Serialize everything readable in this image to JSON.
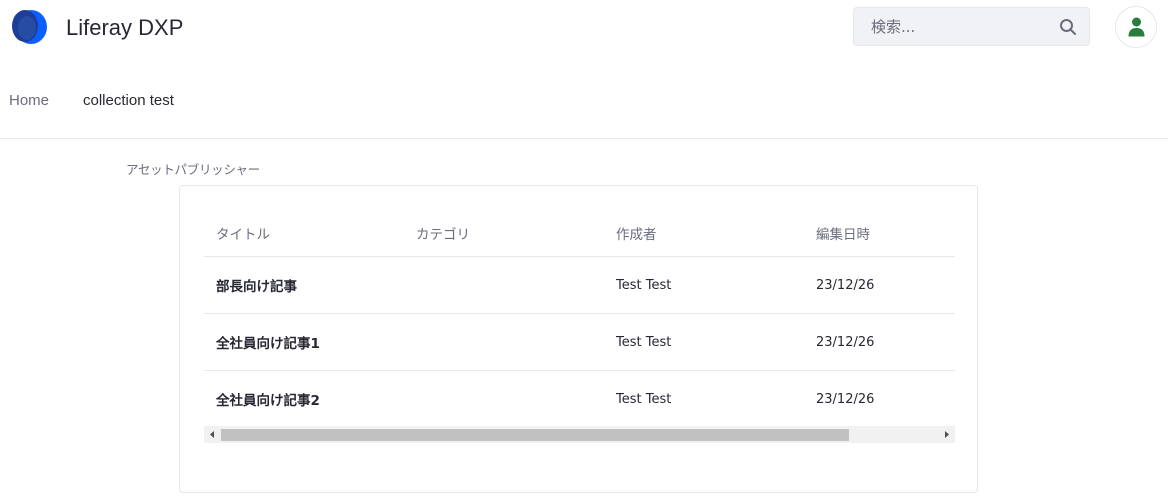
{
  "header": {
    "site_name": "Liferay DXP",
    "logo_icon": "liferay-logo-icon",
    "search": {
      "placeholder": "検索...",
      "value": "",
      "icon": "search-icon"
    },
    "user_icon": "user-icon"
  },
  "breadcrumb": {
    "home": "Home",
    "current": "collection test"
  },
  "portlet": {
    "title": "アセットパブリッシャー",
    "table": {
      "columns": [
        "タイトル",
        "カテゴリ",
        "作成者",
        "編集日時"
      ],
      "rows": [
        {
          "title": "部長向け記事",
          "category": "",
          "author": "Test Test",
          "modified": "23/12/26"
        },
        {
          "title": "全社員向け記事1",
          "category": "",
          "author": "Test Test",
          "modified": "23/12/26"
        },
        {
          "title": "全社員向け記事2",
          "category": "",
          "author": "Test Test",
          "modified": "23/12/26"
        }
      ]
    },
    "scrollbar": {
      "left_arrow": "◂",
      "right_arrow": "▸",
      "position": 0
    }
  },
  "colors": {
    "brand_blue": "#0b5fff",
    "brand_dark": "#1d3d9b",
    "avatar_green": "#287d3c",
    "text_primary": "#272833",
    "text_secondary": "#6b6c7e"
  }
}
